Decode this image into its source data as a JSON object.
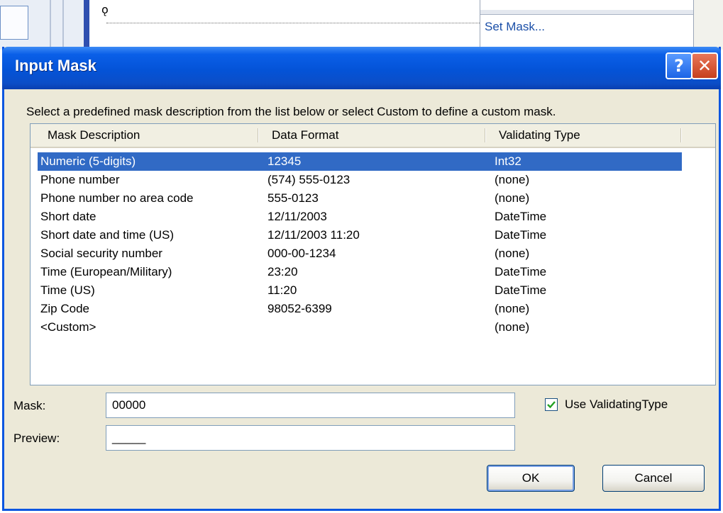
{
  "background": {
    "menu_item": "Set Mask..."
  },
  "dialog": {
    "title": "Input Mask",
    "help_button": "?",
    "close_button": "✕",
    "instructions": "Select a predefined mask description from the list below or select Custom to define a custom mask.",
    "columns": [
      "Mask Description",
      "Data Format",
      "Validating Type"
    ],
    "rows": [
      {
        "description": "Numeric (5-digits)",
        "format": "12345",
        "type": "Int32",
        "selected": true
      },
      {
        "description": "Phone number",
        "format": "(574) 555-0123",
        "type": "(none)"
      },
      {
        "description": "Phone number no area code",
        "format": "555-0123",
        "type": "(none)"
      },
      {
        "description": "Short date",
        "format": "12/11/2003",
        "type": "DateTime"
      },
      {
        "description": "Short date and time (US)",
        "format": "12/11/2003 11:20",
        "type": "DateTime"
      },
      {
        "description": "Social security number",
        "format": "000-00-1234",
        "type": "(none)"
      },
      {
        "description": "Time (European/Military)",
        "format": "23:20",
        "type": "DateTime"
      },
      {
        "description": "Time (US)",
        "format": "11:20",
        "type": "DateTime"
      },
      {
        "description": "Zip Code",
        "format": "98052-6399",
        "type": "(none)"
      },
      {
        "description": "<Custom>",
        "format": "",
        "type": "(none)"
      }
    ],
    "mask_label": "Mask:",
    "mask_value": "00000",
    "preview_label": "Preview:",
    "preview_value": "_____",
    "use_validating_type_label": "Use ValidatingType",
    "use_validating_type_checked": true,
    "ok_label": "OK",
    "cancel_label": "Cancel"
  },
  "colors": {
    "titlebar": "#0453d7",
    "selection": "#316ac5",
    "dialog_face": "#ece9d8",
    "checkmark": "#21a121"
  }
}
